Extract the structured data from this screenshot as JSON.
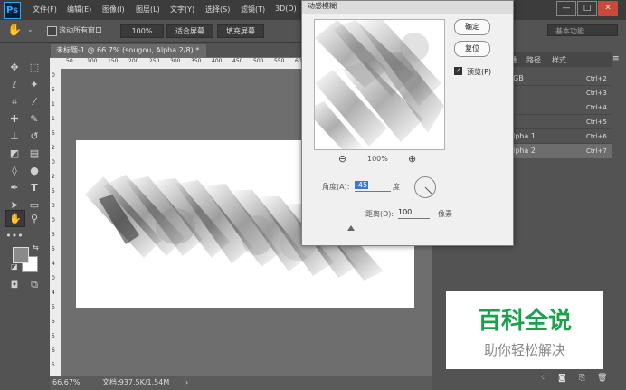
{
  "app": {
    "logo": "Ps"
  },
  "menu": [
    "文件(F)",
    "编辑(E)",
    "图像(I)",
    "图层(L)",
    "文字(Y)",
    "选择(S)",
    "滤镜(T)",
    "3D(D)"
  ],
  "window_controls": {
    "minimize": "—",
    "restore": "□",
    "close": "✕"
  },
  "options": {
    "scroll_all_label": "滚动所有窗口",
    "zoom_value": "100%",
    "fit_screen": "适合屏幕",
    "fill_screen": "填充屏幕",
    "workspace": "基本功能"
  },
  "document": {
    "tab_title": "未标题-1 @ 66.7% (sougou, Alpha 2/8) *",
    "tab_close": "×",
    "ruler_ticks": [
      "50",
      "100",
      "150",
      "200",
      "250",
      "300",
      "350",
      "400",
      "450",
      "500",
      "550",
      "600",
      "650",
      "700",
      "750",
      "800"
    ],
    "ruler_v_ticks": [
      "0",
      "5",
      "1",
      "1",
      "5",
      "2",
      "0",
      "2",
      "5",
      "3",
      "0",
      "3",
      "5",
      "4",
      "0",
      "4",
      "5",
      "5",
      "5",
      "6",
      "5"
    ]
  },
  "status": {
    "zoom": "66.67%",
    "doc_info": "文档:937.5K/1.54M"
  },
  "dialog": {
    "title": "动感模糊",
    "ok": "确定",
    "reset": "复位",
    "preview_label": "预览(P)",
    "preview_checked": true,
    "zoom_level": "100%",
    "zoom_out": "⊖",
    "zoom_in": "⊕",
    "angle_label": "角度(A):",
    "angle_value": "-45",
    "angle_unit": "度",
    "distance_label": "距离(D):",
    "distance_value": "100",
    "distance_unit": "像素",
    "slider_level": 0.3
  },
  "panel": {
    "tabs": [
      "通",
      "路径",
      "样式"
    ],
    "channels": [
      {
        "name": "GB",
        "shortcut": "Ctrl+2"
      },
      {
        "name": "",
        "shortcut": "Ctrl+3"
      },
      {
        "name": "",
        "shortcut": "Ctrl+4"
      },
      {
        "name": "",
        "shortcut": "Ctrl+5"
      },
      {
        "name": "lpha 1",
        "shortcut": "Ctrl+6"
      },
      {
        "name": "lpha 2",
        "shortcut": "Ctrl+7"
      }
    ]
  },
  "watermark": {
    "title": "百科全说",
    "subtitle": "助你轻松解决"
  },
  "colors": {
    "accent": "#31a8ff",
    "watermark_green": "#1aa14c",
    "selection": "#3a79d3"
  }
}
